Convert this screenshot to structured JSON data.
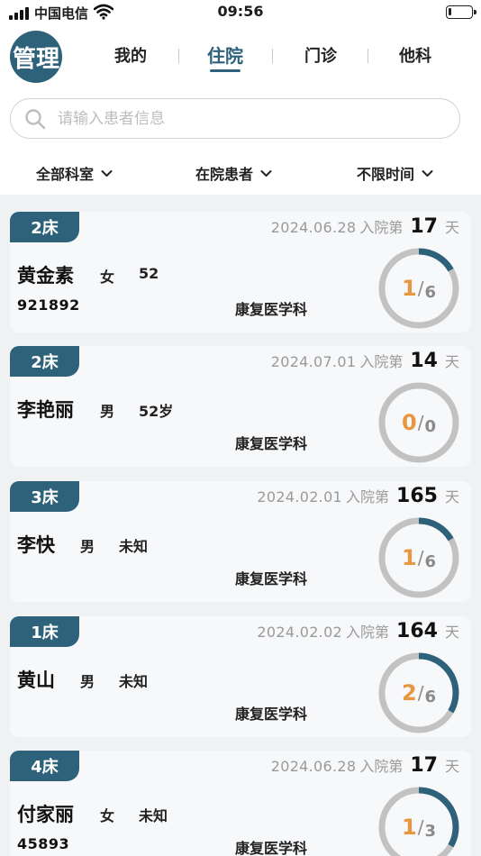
{
  "status_bar": {
    "carrier": "中国电信",
    "time": "09:56",
    "battery_level": 0.15
  },
  "header": {
    "avatar_text": "管理",
    "tabs": [
      {
        "label": "我的",
        "active": false
      },
      {
        "label": "住院",
        "active": true
      },
      {
        "label": "门诊",
        "active": false
      },
      {
        "label": "他科",
        "active": false
      }
    ]
  },
  "search": {
    "placeholder": "请输入患者信息",
    "value": ""
  },
  "filters": [
    {
      "label": "全部科室"
    },
    {
      "label": "在院患者"
    },
    {
      "label": "不限时间"
    }
  ],
  "colors": {
    "accent": "#2e627a",
    "highlight": "#e8963f",
    "ring_track": "#c2c2c2"
  },
  "patients": [
    {
      "bed": "2床",
      "date": "2024.06.28",
      "admit_prefix": "入院第",
      "days": "17",
      "day_unit": "天",
      "name": "黄金素",
      "gender": "女",
      "age": "52",
      "pid": "921892",
      "dept": "康复医学科",
      "done": "1",
      "total": "6",
      "progress": 0.1667
    },
    {
      "bed": "2床",
      "date": "2024.07.01",
      "admit_prefix": "入院第",
      "days": "14",
      "day_unit": "天",
      "name": "李艳丽",
      "gender": "男",
      "age": "52岁",
      "pid": "",
      "dept": "康复医学科",
      "done": "0",
      "total": "0",
      "progress": 0
    },
    {
      "bed": "3床",
      "date": "2024.02.01",
      "admit_prefix": "入院第",
      "days": "165",
      "day_unit": "天",
      "name": "李快",
      "gender": "男",
      "age": "未知",
      "pid": "",
      "dept": "康复医学科",
      "done": "1",
      "total": "6",
      "progress": 0.1667
    },
    {
      "bed": "1床",
      "date": "2024.02.02",
      "admit_prefix": "入院第",
      "days": "164",
      "day_unit": "天",
      "name": "黄山",
      "gender": "男",
      "age": "未知",
      "pid": "",
      "dept": "康复医学科",
      "done": "2",
      "total": "6",
      "progress": 0.3333
    },
    {
      "bed": "4床",
      "date": "2024.06.28",
      "admit_prefix": "入院第",
      "days": "17",
      "day_unit": "天",
      "name": "付家丽",
      "gender": "女",
      "age": "未知",
      "pid": "45893",
      "dept": "康复医学科",
      "done": "1",
      "total": "3",
      "progress": 0.3333
    }
  ]
}
